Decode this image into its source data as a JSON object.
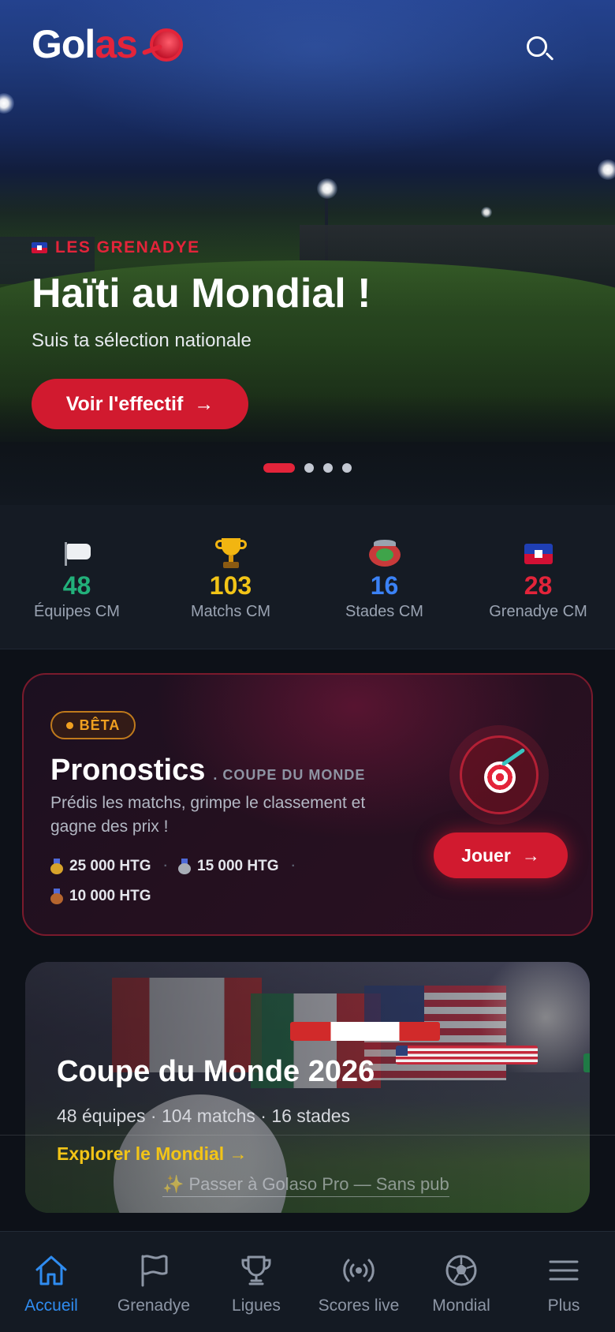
{
  "app": {
    "logo_part1": "Gol",
    "logo_part2": "as"
  },
  "hero": {
    "tag": "LES GRENADYE",
    "title": "Haïti au Mondial !",
    "subtitle": "Suis ta sélection nationale",
    "cta_label": "Voir l'effectif",
    "cta_arrow": "→",
    "carousel_total": 4,
    "carousel_active": 1
  },
  "stats": [
    {
      "icon": "white-flag-icon",
      "value": "48",
      "label": "Équipes CM",
      "color": "#22b07a"
    },
    {
      "icon": "trophy-icon",
      "value": "103",
      "label": "Matchs CM",
      "color": "#f2c417"
    },
    {
      "icon": "stadium-icon",
      "value": "16",
      "label": "Stades CM",
      "color": "#3b82f6"
    },
    {
      "icon": "haiti-flag-icon",
      "value": "28",
      "label": "Grenadye CM",
      "color": "#e3243a"
    }
  ],
  "pronostics": {
    "badge": "BÊTA",
    "title": "Pronostics",
    "subtitle": ". COUPE DU MONDE",
    "description": "Prédis les matchs, grimpe le classement et gagne des prix !",
    "prizes": [
      {
        "medal": "gold",
        "amount": "25 000 HTG"
      },
      {
        "medal": "silver",
        "amount": "15 000 HTG"
      },
      {
        "medal": "bronze",
        "amount": "10 000 HTG"
      }
    ],
    "separator": "·",
    "cta_label": "Jouer",
    "cta_arrow": "→"
  },
  "world_cup": {
    "title": "Coupe du Monde 2026",
    "subtitle": "48 équipes · 104 matchs · 16 stades",
    "link": "Explorer le Mondial →",
    "pro_link": "✨ Passer à Golaso Pro — Sans pub"
  },
  "nav": [
    {
      "label": "Accueil",
      "icon": "home-icon",
      "active": true
    },
    {
      "label": "Grenadye",
      "icon": "flag-icon",
      "active": false
    },
    {
      "label": "Ligues",
      "icon": "trophy-icon",
      "active": false
    },
    {
      "label": "Scores live",
      "icon": "broadcast-icon",
      "active": false
    },
    {
      "label": "Mondial",
      "icon": "soccer-ball-icon",
      "active": false
    },
    {
      "label": "Plus",
      "icon": "menu-icon",
      "active": false
    }
  ],
  "colors": {
    "accent_red": "#d11a2f",
    "active_blue": "#2f8cf0",
    "gold": "#f2c417",
    "background": "#0d1118"
  }
}
